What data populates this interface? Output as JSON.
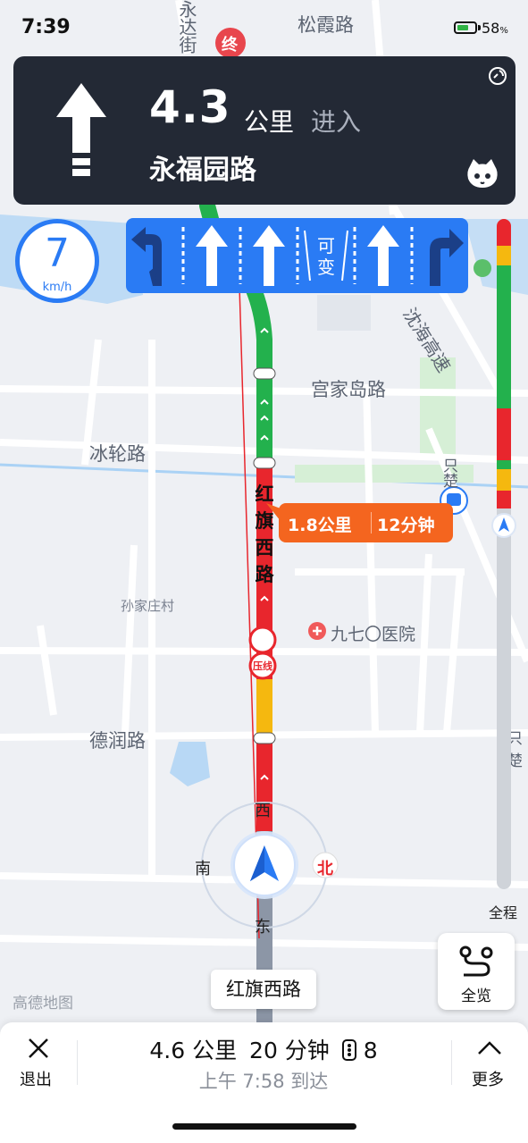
{
  "status": {
    "time": "7:39",
    "battery": "58",
    "battery_unit": "%",
    "battery_level": 0.58
  },
  "nav": {
    "distance": "4.3",
    "unit": "公里",
    "action": "进入",
    "next_road": "永福园路",
    "maneuver": "straight-arrow-icon"
  },
  "speed": {
    "value": "7",
    "unit": "km/h"
  },
  "lanes": [
    {
      "type": "left-uturn",
      "highlight": false
    },
    {
      "type": "straight",
      "highlight": true
    },
    {
      "type": "straight",
      "highlight": true
    },
    {
      "type": "variable",
      "label": "可变"
    },
    {
      "type": "straight",
      "highlight": true
    },
    {
      "type": "right",
      "highlight": false
    }
  ],
  "destination_marker": "终",
  "callout": {
    "distance": "1.8公里",
    "time": "12分钟"
  },
  "map": {
    "labels": {
      "songxia": "松霞路",
      "yongda": "永达街",
      "shenhai": "沈海高速",
      "gongjiadao": "宫家岛路",
      "binglun": "冰轮路",
      "sunjiazhuang": "孙家庄村",
      "hospital": "九七〇医院",
      "derun": "德润路",
      "zhishi": "只楚",
      "zhiqu": "只楚",
      "honggi_vertical": [
        "红",
        "旗",
        "西",
        "路"
      ],
      "keyi": "可变",
      "camera_label": "压线"
    },
    "amap_logo": "高德地图"
  },
  "compass": {
    "west": "西",
    "south": "南",
    "north": "北",
    "east": "东"
  },
  "progress": {
    "label": "全程",
    "traveled": 0.45,
    "segments": [
      "red",
      "orange",
      "green",
      "red",
      "green",
      "orange",
      "red",
      "gray"
    ]
  },
  "current_road": "红旗西路",
  "overview": {
    "label": "全览"
  },
  "bottom": {
    "exit": "退出",
    "remaining_distance": "4.6 公里",
    "remaining_time": "20 分钟",
    "traffic_lights": "8",
    "eta": "上午 7:58 到达",
    "more": "更多"
  },
  "colors": {
    "route_green": "#23b14d",
    "route_red": "#e8262d",
    "route_yellow": "#f5b80f",
    "accent_blue": "#2a7bf4",
    "callout_orange": "#f4651f",
    "banner_bg": "#232935"
  }
}
